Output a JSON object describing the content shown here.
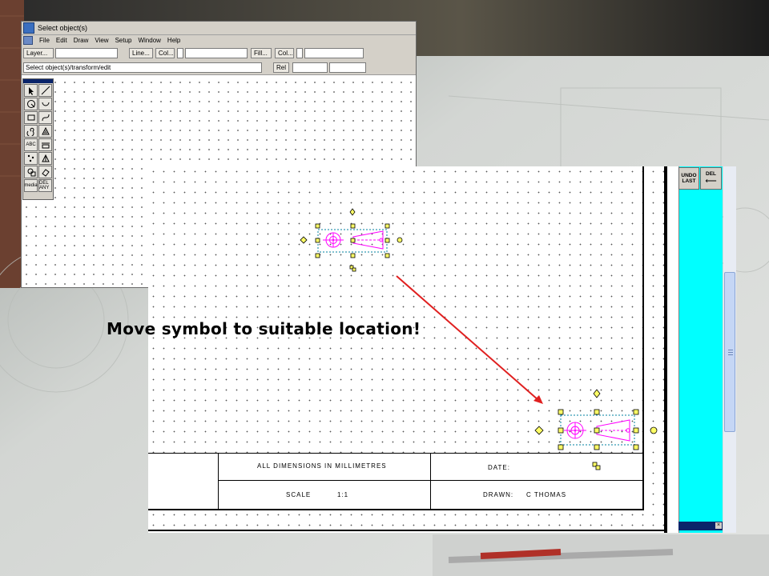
{
  "app": {
    "title": "Select object(s)",
    "menu": [
      "File",
      "Edit",
      "Draw",
      "View",
      "Setup",
      "Window",
      "Help"
    ],
    "toolbar": {
      "layer_label": "Layer...",
      "line_label": "Line...",
      "col_label_1": "Col...",
      "fill_label": "Fill...",
      "col_label_2": "Col..."
    },
    "command_field": "Select object(s)/transform/edit",
    "rel_label": "Rel"
  },
  "palette": {
    "tools": [
      "select-arrow",
      "line",
      "circle",
      "arc",
      "rectangle",
      "curve",
      "spiral",
      "hatch",
      "text",
      "dimension",
      "points",
      "measure",
      "symbol",
      "erase"
    ],
    "text_cells": {
      "abc": "ABC",
      "media": "media",
      "del_any": "DEL ANY"
    }
  },
  "title_block": {
    "dimensions_note": "ALL DIMENSIONS IN MILLIMETRES",
    "date_label": "DATE:",
    "scale_label": "SCALE",
    "scale_value": "1:1",
    "drawn_label": "DRAWN:",
    "drawn_value": "C THOMAS"
  },
  "side_panel": {
    "undo_label_1": "UNDO",
    "undo_label_2": "LAST",
    "del_label": "DEL",
    "del_arrow": "⟵"
  },
  "callout": {
    "text": "Move symbol to suitable location!"
  },
  "colors": {
    "symbol": "#ff00ff",
    "handles": "#ffff66",
    "selection_box": "#0080a0",
    "arrow": "#e02020",
    "side_panel": "#00ffff"
  }
}
